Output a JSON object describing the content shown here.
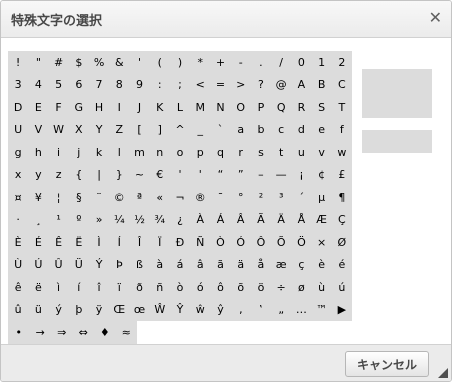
{
  "dialog": {
    "title": "特殊文字の選択",
    "close_icon": "close-icon",
    "cancel_label": "キャンセル"
  },
  "rows": [
    [
      "!",
      "\"",
      "#",
      "$",
      "%",
      "&",
      "'",
      "(",
      ")",
      "*",
      "+",
      "-",
      ".",
      "/",
      "0",
      "1",
      "2"
    ],
    [
      "3",
      "4",
      "5",
      "6",
      "7",
      "8",
      "9",
      ":",
      ";",
      "<",
      "=",
      ">",
      "?",
      "@",
      "A",
      "B",
      "C"
    ],
    [
      "D",
      "E",
      "F",
      "G",
      "H",
      "I",
      "J",
      "K",
      "L",
      "M",
      "N",
      "O",
      "P",
      "Q",
      "R",
      "S",
      "T"
    ],
    [
      "U",
      "V",
      "W",
      "X",
      "Y",
      "Z",
      "[",
      "]",
      "^",
      "_",
      "`",
      "a",
      "b",
      "c",
      "d",
      "e",
      "f"
    ],
    [
      "g",
      "h",
      "i",
      "j",
      "k",
      "l",
      "m",
      "n",
      "o",
      "p",
      "q",
      "r",
      "s",
      "t",
      "u",
      "v",
      "w"
    ],
    [
      "x",
      "y",
      "z",
      "{",
      "|",
      "}",
      "~",
      "€",
      "'",
      "'",
      "“",
      "”",
      "–",
      "—",
      "¡",
      "¢",
      "£"
    ],
    [
      "¤",
      "¥",
      "¦",
      "§",
      "¨",
      "©",
      "ª",
      "«",
      "¬",
      "®",
      "¯",
      "°",
      "²",
      "³",
      "´",
      "µ",
      "¶"
    ],
    [
      "·",
      "¸",
      "¹",
      "º",
      "»",
      "¼",
      "½",
      "¾",
      "¿",
      "À",
      "Á",
      "Â",
      "Ã",
      "Ä",
      "Å",
      "Æ",
      "Ç"
    ],
    [
      "È",
      "É",
      "Ê",
      "Ë",
      "Ì",
      "Í",
      "Î",
      "Ï",
      "Ð",
      "Ñ",
      "Ò",
      "Ó",
      "Ô",
      "Õ",
      "Ö",
      "×",
      "Ø"
    ],
    [
      "Ù",
      "Ú",
      "Û",
      "Ü",
      "Ý",
      "Þ",
      "ß",
      "à",
      "á",
      "â",
      "ã",
      "ä",
      "å",
      "æ",
      "ç",
      "è",
      "é"
    ],
    [
      "ê",
      "ë",
      "ì",
      "í",
      "î",
      "ï",
      "ð",
      "ñ",
      "ò",
      "ó",
      "ô",
      "õ",
      "ö",
      "÷",
      "ø",
      "ù",
      "ú"
    ],
    [
      "û",
      "ü",
      "ý",
      "þ",
      "ÿ",
      "Œ",
      "œ",
      "Ŵ",
      "Ŷ",
      "ŵ",
      "ŷ",
      "‚",
      "‛",
      "„",
      "…",
      "™",
      "▶"
    ],
    [
      "•",
      "→",
      "⇒",
      "⇔",
      "♦",
      "≈"
    ]
  ],
  "colors": {
    "cell_bg": "#dcdcdc",
    "footer_bg": "#ebebeb",
    "title_text": "#484848"
  }
}
